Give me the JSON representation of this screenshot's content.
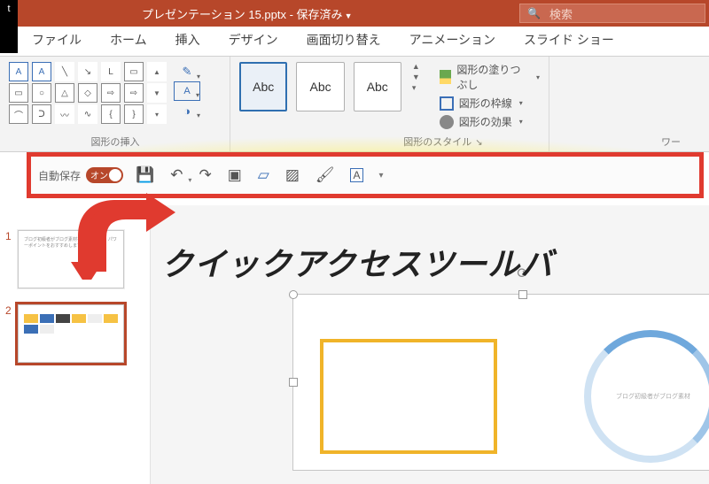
{
  "titlebar": {
    "left_glyph": "t",
    "filename": "プレゼンテーション 15.pptx - 保存済み",
    "search_placeholder": "検索"
  },
  "menu": {
    "file": "ファイル",
    "home": "ホーム",
    "insert": "挿入",
    "design": "デザイン",
    "transition": "画面切り替え",
    "animation": "アニメーション",
    "slideshow": "スライド ショー"
  },
  "ribbon": {
    "group_insert": "図形の挿入",
    "group_styles": "図形のスタイル",
    "group_wa": "ワー",
    "style_label": "Abc",
    "fill": "図形の塗りつぶし",
    "outline": "図形の枠線",
    "effects": "図形の効果"
  },
  "qat": {
    "autosave": "自動保存",
    "toggle": "オン"
  },
  "annotation": {
    "text": "クイックアクセスツールバ"
  },
  "thumbs": {
    "n1": "1",
    "n2": "2",
    "t1": "ブログ初級者がブログ素材をつくるには、パワーポイントをおすすめします！"
  }
}
